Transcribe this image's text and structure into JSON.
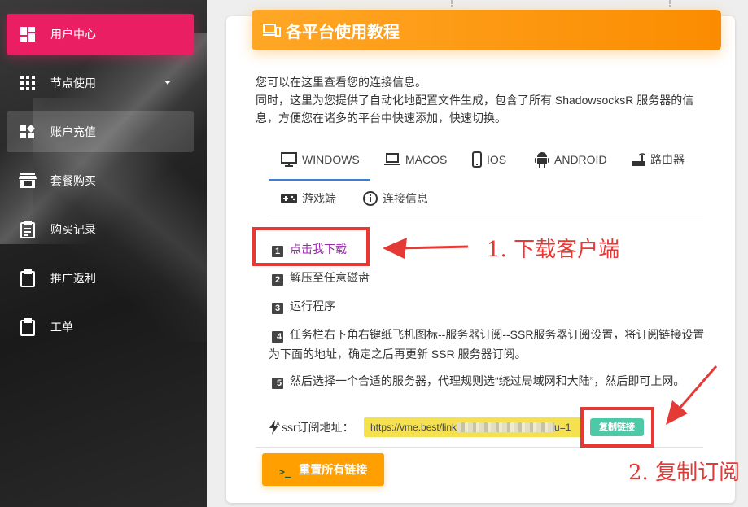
{
  "sidebar": {
    "items": [
      {
        "label": "用户中心",
        "icon": "dashboard-icon",
        "state": "active"
      },
      {
        "label": "节点使用",
        "icon": "grid-icon",
        "state": "normal",
        "has_caret": true
      },
      {
        "label": "账户充值",
        "icon": "widgets-icon",
        "state": "hover"
      },
      {
        "label": "套餐购买",
        "icon": "store-icon",
        "state": "normal"
      },
      {
        "label": "购买记录",
        "icon": "receipt-icon",
        "state": "normal"
      },
      {
        "label": "推广返利",
        "icon": "clipboard-icon",
        "state": "normal"
      },
      {
        "label": "工单",
        "icon": "clipboard-icon",
        "state": "normal"
      }
    ],
    "active_color": "#e91e63"
  },
  "card": {
    "title": "各平台使用教程",
    "header_color": "#fb8c00",
    "desc_line1": "您可以在这里查看您的连接信息。",
    "desc_line2": "同时，这里为您提供了自动化地配置文件生成，包含了所有 ShadowsocksR 服务器的信息，方便您在诸多的平台中快速添加，快速切换。"
  },
  "tabs": [
    {
      "label": "WINDOWS",
      "icon": "desktop-icon",
      "active": true
    },
    {
      "label": "MACOS",
      "icon": "laptop-icon"
    },
    {
      "label": "IOS",
      "icon": "phone-icon"
    },
    {
      "label": "ANDROID",
      "icon": "android-icon"
    },
    {
      "label": "路由器",
      "icon": "router-icon"
    },
    {
      "label": "游戏端",
      "icon": "gamepad-icon"
    },
    {
      "label": "连接信息",
      "icon": "info-icon"
    }
  ],
  "steps": {
    "s1": {
      "num": "1",
      "text": "点击我下载"
    },
    "s2": {
      "num": "2",
      "text": "解压至任意磁盘"
    },
    "s3": {
      "num": "3",
      "text": "运行程序"
    },
    "s4": {
      "num": "4",
      "text": "任务栏右下角右键纸飞机图标--服务器订阅--SSR服务器订阅设置，将订阅链接设置为下面的地址，确定之后再更新 SSR 服务器订阅。"
    },
    "s5": {
      "num": "5",
      "text": "然后选择一个合适的服务器，代理规则选“绕过局域网和大陆”，然后即可上网。"
    }
  },
  "ssr": {
    "label": "ssr订阅地址：",
    "url_start": "https://vme.best/link",
    "url_end": "u=1",
    "copy_label": "复制链接",
    "field_color": "#f5e050"
  },
  "reset": {
    "label": "重置所有链接",
    "prompt": ">_"
  },
  "annotations": {
    "download": "1. 下载客户端",
    "copy": "2. 复制订阅",
    "color": "#e53935"
  }
}
